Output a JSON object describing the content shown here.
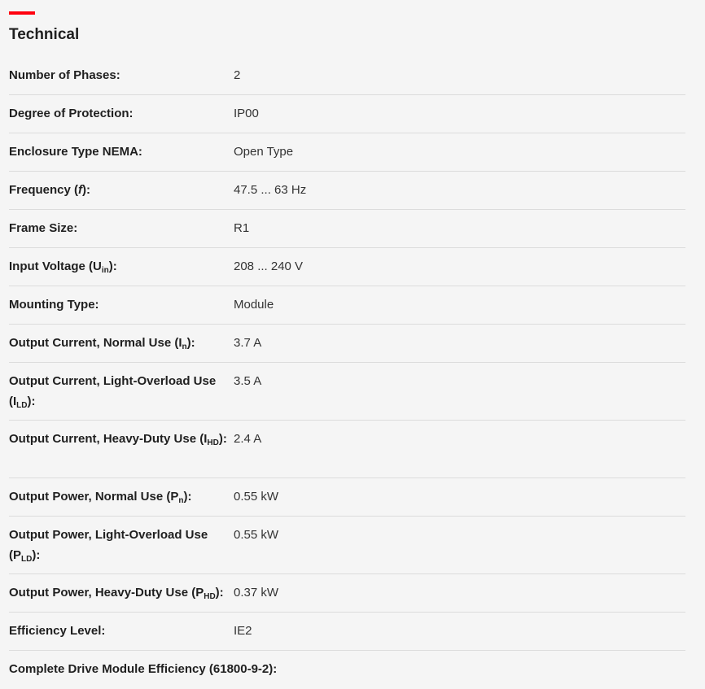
{
  "section": {
    "title": "Technical",
    "accent_color": "#ff000f"
  },
  "specs": [
    {
      "label": "Number of Phases:",
      "value": "2"
    },
    {
      "label": "Degree of Protection:",
      "value": "IP00"
    },
    {
      "label": "Enclosure Type NEMA:",
      "value": "Open Type"
    },
    {
      "label_pre": "Frequency (",
      "label_italic": "f",
      "label_post": "):",
      "value": "47.5 ... 63 Hz"
    },
    {
      "label": "Frame Size:",
      "value": "R1"
    },
    {
      "label_pre": "Input Voltage (U",
      "label_sub": "in",
      "label_post": "):",
      "value": "208 ... 240 V"
    },
    {
      "label": "Mounting Type:",
      "value": "Module"
    },
    {
      "label_pre": "Output Current, Normal Use (I",
      "label_sub": "n",
      "label_post": "):",
      "value": "3.7 A"
    },
    {
      "label_pre": "Output Current, Light-Overload Use (I",
      "label_sub": "LD",
      "label_post": "):",
      "value": "3.5 A"
    },
    {
      "label_pre": "Output Current, Heavy-Duty Use (I",
      "label_sub": "HD",
      "label_post": "):",
      "value": "2.4 A"
    },
    {
      "label_pre": "Output Power, Normal Use (P",
      "label_sub": "n",
      "label_post": "):",
      "value": "0.55 kW"
    },
    {
      "label_pre": "Output Power, Light-Overload Use (P",
      "label_sub": "LD",
      "label_post": "):",
      "value": "0.55 kW"
    },
    {
      "label_pre": "Output Power, Heavy-Duty Use (P",
      "label_sub": "HD",
      "label_post": "):",
      "value": "0.37 kW"
    },
    {
      "label": "Efficiency Level:",
      "value": "IE2"
    },
    {
      "label": "Complete Drive Module Efficiency (61800-9-2):",
      "value": ""
    }
  ]
}
